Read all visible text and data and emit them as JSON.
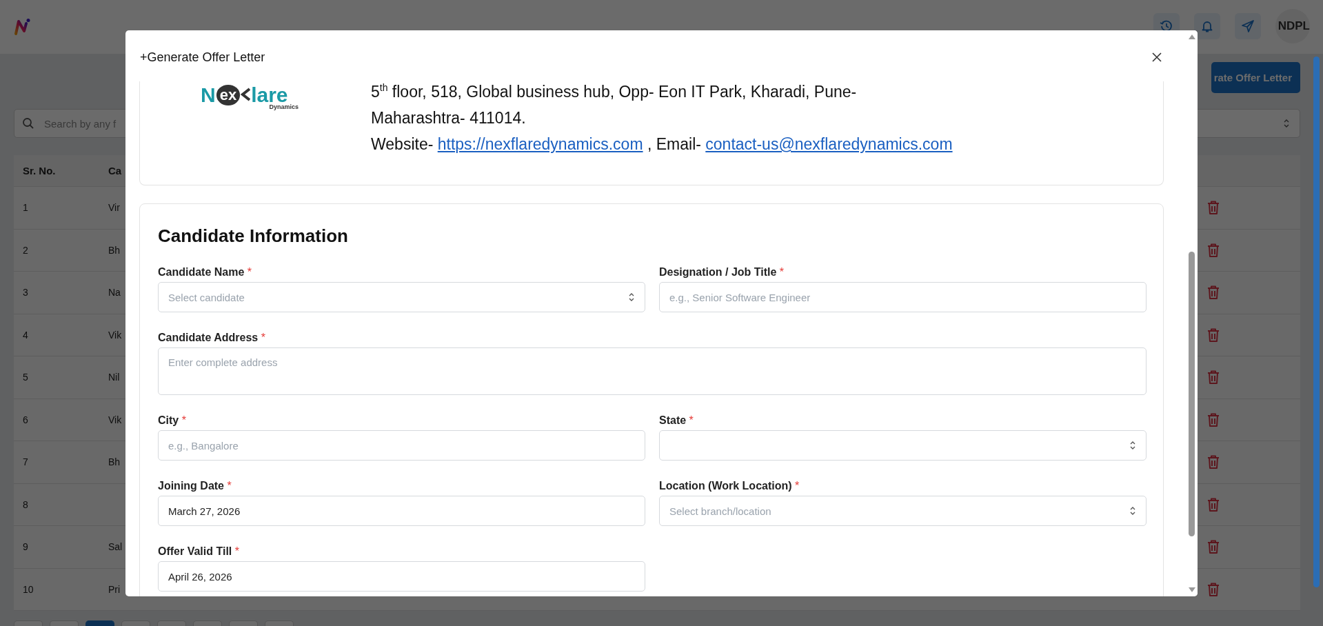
{
  "app": {
    "user_initials": "NDPL"
  },
  "page": {
    "generate_button": "rate Offer Letter",
    "search": {
      "placeholder": "Search by any f"
    },
    "table": {
      "columns": [
        "Sr. No.",
        "Ca"
      ],
      "rows": [
        {
          "sr_no": "1",
          "name": "Vir"
        },
        {
          "sr_no": "2",
          "name": "Bh"
        },
        {
          "sr_no": "3",
          "name": "Na"
        },
        {
          "sr_no": "4",
          "name": "Vik"
        },
        {
          "sr_no": "5",
          "name": "Nil"
        },
        {
          "sr_no": "6",
          "name": "Vik"
        },
        {
          "sr_no": "7",
          "name": "Bh"
        },
        {
          "sr_no": "8"
        },
        {
          "sr_no": "9",
          "name": "Sal"
        },
        {
          "sr_no": "10",
          "name": "Pri"
        }
      ]
    },
    "pagination": [
      {
        "selected": false
      },
      {
        "selected": false
      },
      {
        "selected": true
      },
      {
        "selected": false
      },
      {
        "selected": false
      },
      {
        "selected": false
      },
      {
        "selected": false
      },
      {
        "selected": false
      }
    ]
  },
  "modal": {
    "title": "+Generate Offer Letter",
    "letterhead": {
      "logo": {
        "parts": [
          "N",
          "ex",
          "lare"
        ],
        "tagline": "Dynamics"
      },
      "address_lines": [
        "5$^{th}$ floor, 518, Global business hub, Opp- Eon IT Park, Kharadi, Pune-",
        "Maharashtra- 411014."
      ],
      "website_label": "Website- ",
      "website": "https://nexflaredynamics.com",
      "email_label": " , Email- ",
      "email": "contact-us@nexflaredynamics.com"
    },
    "section": {
      "title": "Candidate Information",
      "rows": [
        [
          {
            "kind": "select",
            "label": "Candidate Name",
            "required_mark": "*",
            "placeholder": "Select candidate"
          },
          {
            "kind": "input",
            "label": "Designation / Job Title",
            "required_mark": "*",
            "placeholder": "e.g., Senior Software Engineer"
          }
        ],
        [
          {
            "kind": "textarea",
            "label": "Candidate Address",
            "required_mark": "*",
            "placeholder": "Enter complete address"
          }
        ],
        [
          {
            "kind": "input",
            "label": "City",
            "required_mark": "*",
            "placeholder": "e.g., Bangalore"
          },
          {
            "kind": "select",
            "label": "State",
            "required_mark": "*"
          }
        ],
        [
          {
            "kind": "input",
            "label": "Joining Date",
            "required_mark": "*",
            "value": "March 27, 2026"
          },
          {
            "kind": "select",
            "label": "Location (Work Location)",
            "required_mark": "*",
            "placeholder": "Select branch/location"
          }
        ],
        [
          {
            "kind": "input",
            "label": "Offer Valid Till",
            "required_mark": "*",
            "value": "April 26, 2026"
          }
        ]
      ]
    }
  }
}
